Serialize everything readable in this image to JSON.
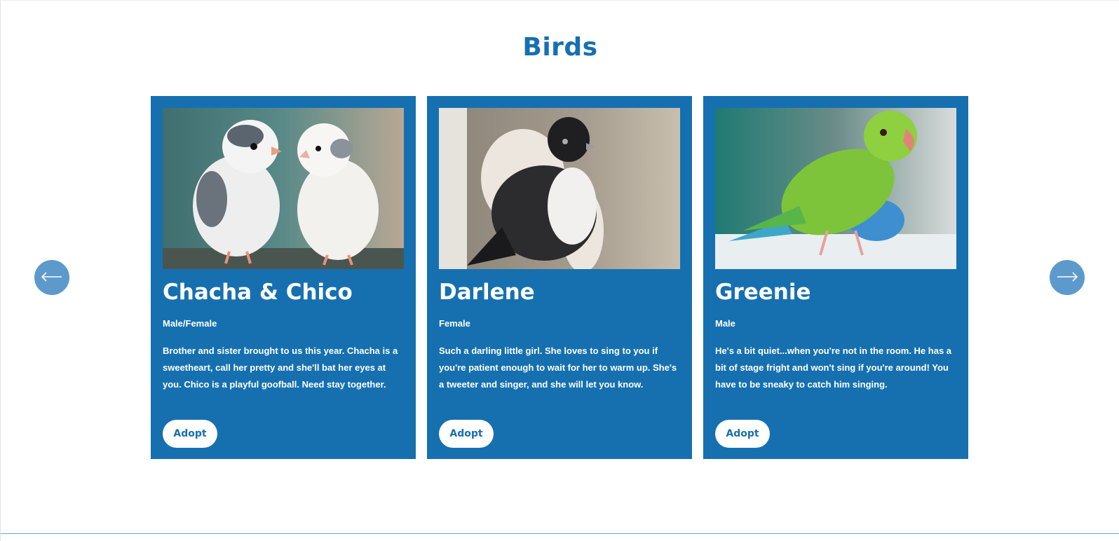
{
  "section": {
    "title": "Birds"
  },
  "carousel": {
    "prev_icon": "arrow-left-icon",
    "next_icon": "arrow-right-icon",
    "button_color": "#5d9acb"
  },
  "colors": {
    "accent": "#1670b0",
    "card_bg": "#1670b0",
    "text_on_card": "#ffffff"
  },
  "cards": [
    {
      "name": "Chacha & Chico",
      "sex": "Male/Female",
      "description": "Brother and sister brought to us this year. Chacha is a sweetheart, call her pretty and she'll bat her eyes at you. Chico is a playful goofball. Need stay together.",
      "button": "Adopt",
      "photo_icon": "two-white-birds-photo"
    },
    {
      "name": "Darlene",
      "sex": "Female",
      "description": "Such a darling little girl. She loves to sing to you if you're patient enough to wait for her to warm up.  She's a tweeter and singer, and she will let you know.",
      "button": "Adopt",
      "photo_icon": "black-white-bird-in-glove-photo"
    },
    {
      "name": "Greenie",
      "sex": "Male",
      "description": "He's a bit quiet...when you're not in the room. He has a bit of stage fright and won't sing if you're around! You have to be sneaky to catch him singing.",
      "button": "Adopt",
      "photo_icon": "green-parrot-photo"
    }
  ]
}
